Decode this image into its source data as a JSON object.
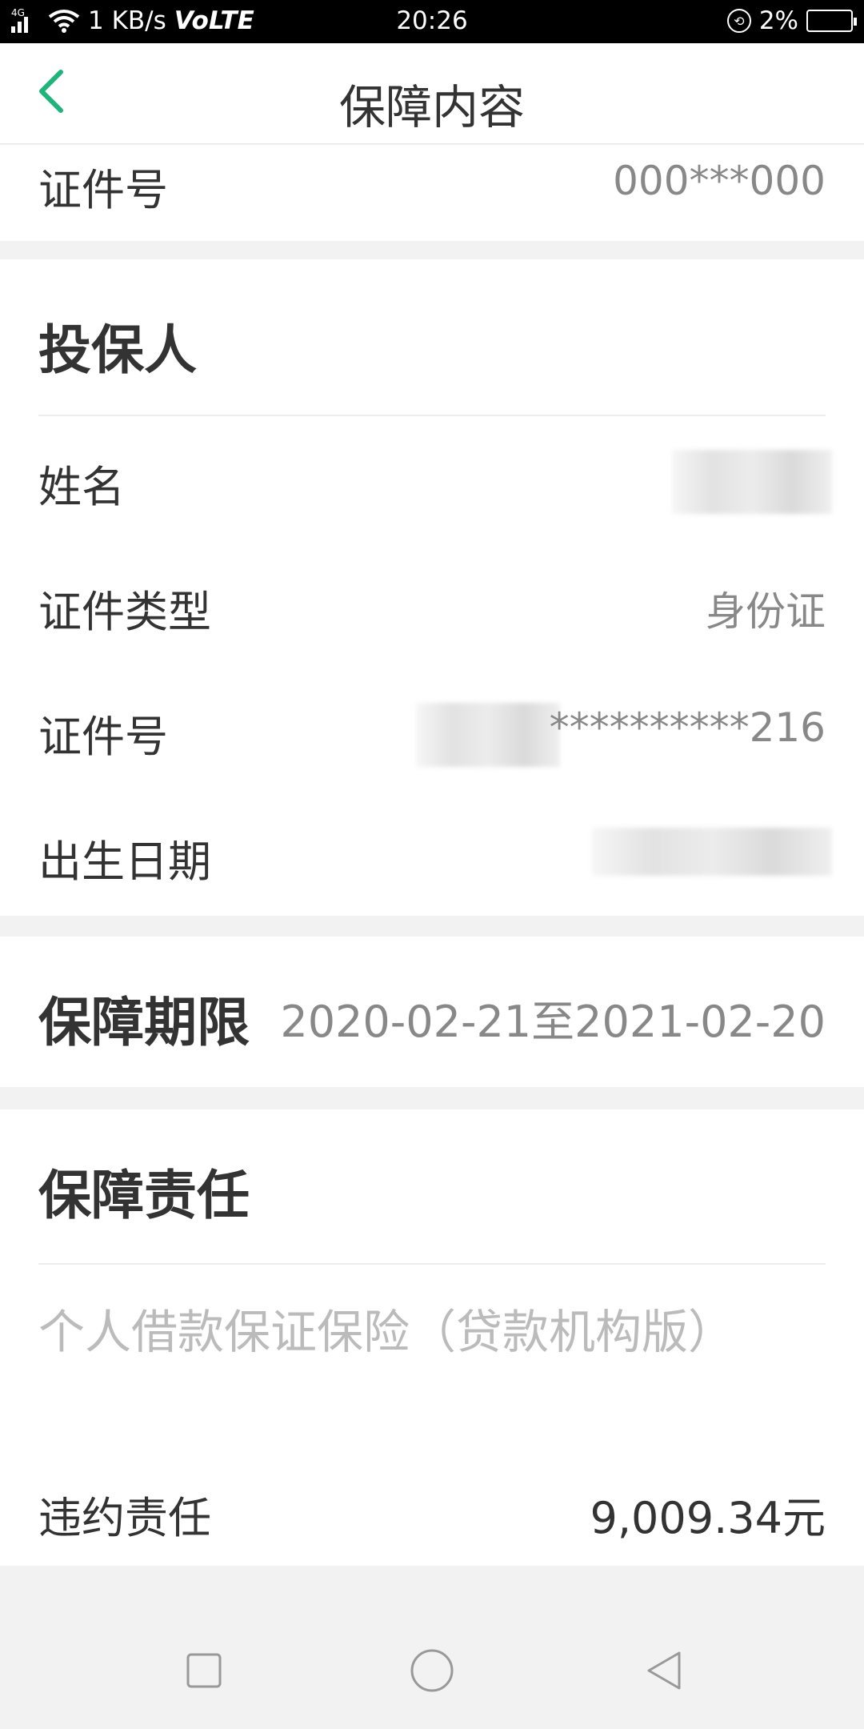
{
  "status_bar": {
    "network": "4G",
    "speed": "1 KB/s",
    "volte": "VoLTE",
    "time": "20:26",
    "battery": "2%"
  },
  "header": {
    "title": "保障内容",
    "back_icon": "chevron-left-icon",
    "accent": "#1fb47b"
  },
  "insured": {
    "id_label": "证件号",
    "id_value": "000***000"
  },
  "policyholder": {
    "title": "投保人",
    "name_label": "姓名",
    "id_type_label": "证件类型",
    "id_type_value": "身份证",
    "id_label": "证件号",
    "id_value": "**********216",
    "birth_label": "出生日期"
  },
  "period": {
    "label": "保障期限",
    "value": "2020-02-21至2021-02-20"
  },
  "liability": {
    "title": "保障责任",
    "product_name": "个人借款保证保险（贷款机构版）",
    "default_label": "违约责任",
    "default_value": "9,009.34元"
  },
  "nav": {
    "recents_icon": "square-icon",
    "home_icon": "circle-icon",
    "back_icon": "triangle-back-icon"
  }
}
